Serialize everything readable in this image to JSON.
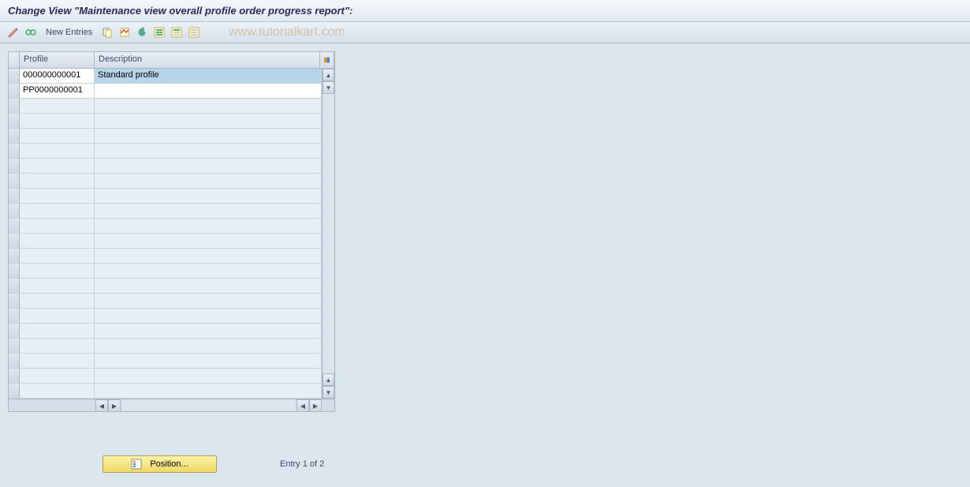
{
  "title": "Change View \"Maintenance view overall profile order progress report\":",
  "toolbar": {
    "new_entries_label": "New Entries",
    "icons": [
      "pencil-glasses",
      "glasses",
      "copy",
      "save",
      "undo",
      "select-all",
      "select-block",
      "deselect"
    ]
  },
  "watermark": "www.tutorialkart.com",
  "table": {
    "columns": {
      "profile": "Profile",
      "description": "Description"
    },
    "rows": [
      {
        "profile": "000000000001",
        "description": "Standard profile",
        "selected": true
      },
      {
        "profile": "PP0000000001",
        "description": "",
        "selected": false
      }
    ],
    "empty_row_count": 20
  },
  "footer": {
    "position_label": "Position...",
    "entry_text": "Entry 1 of 2"
  }
}
